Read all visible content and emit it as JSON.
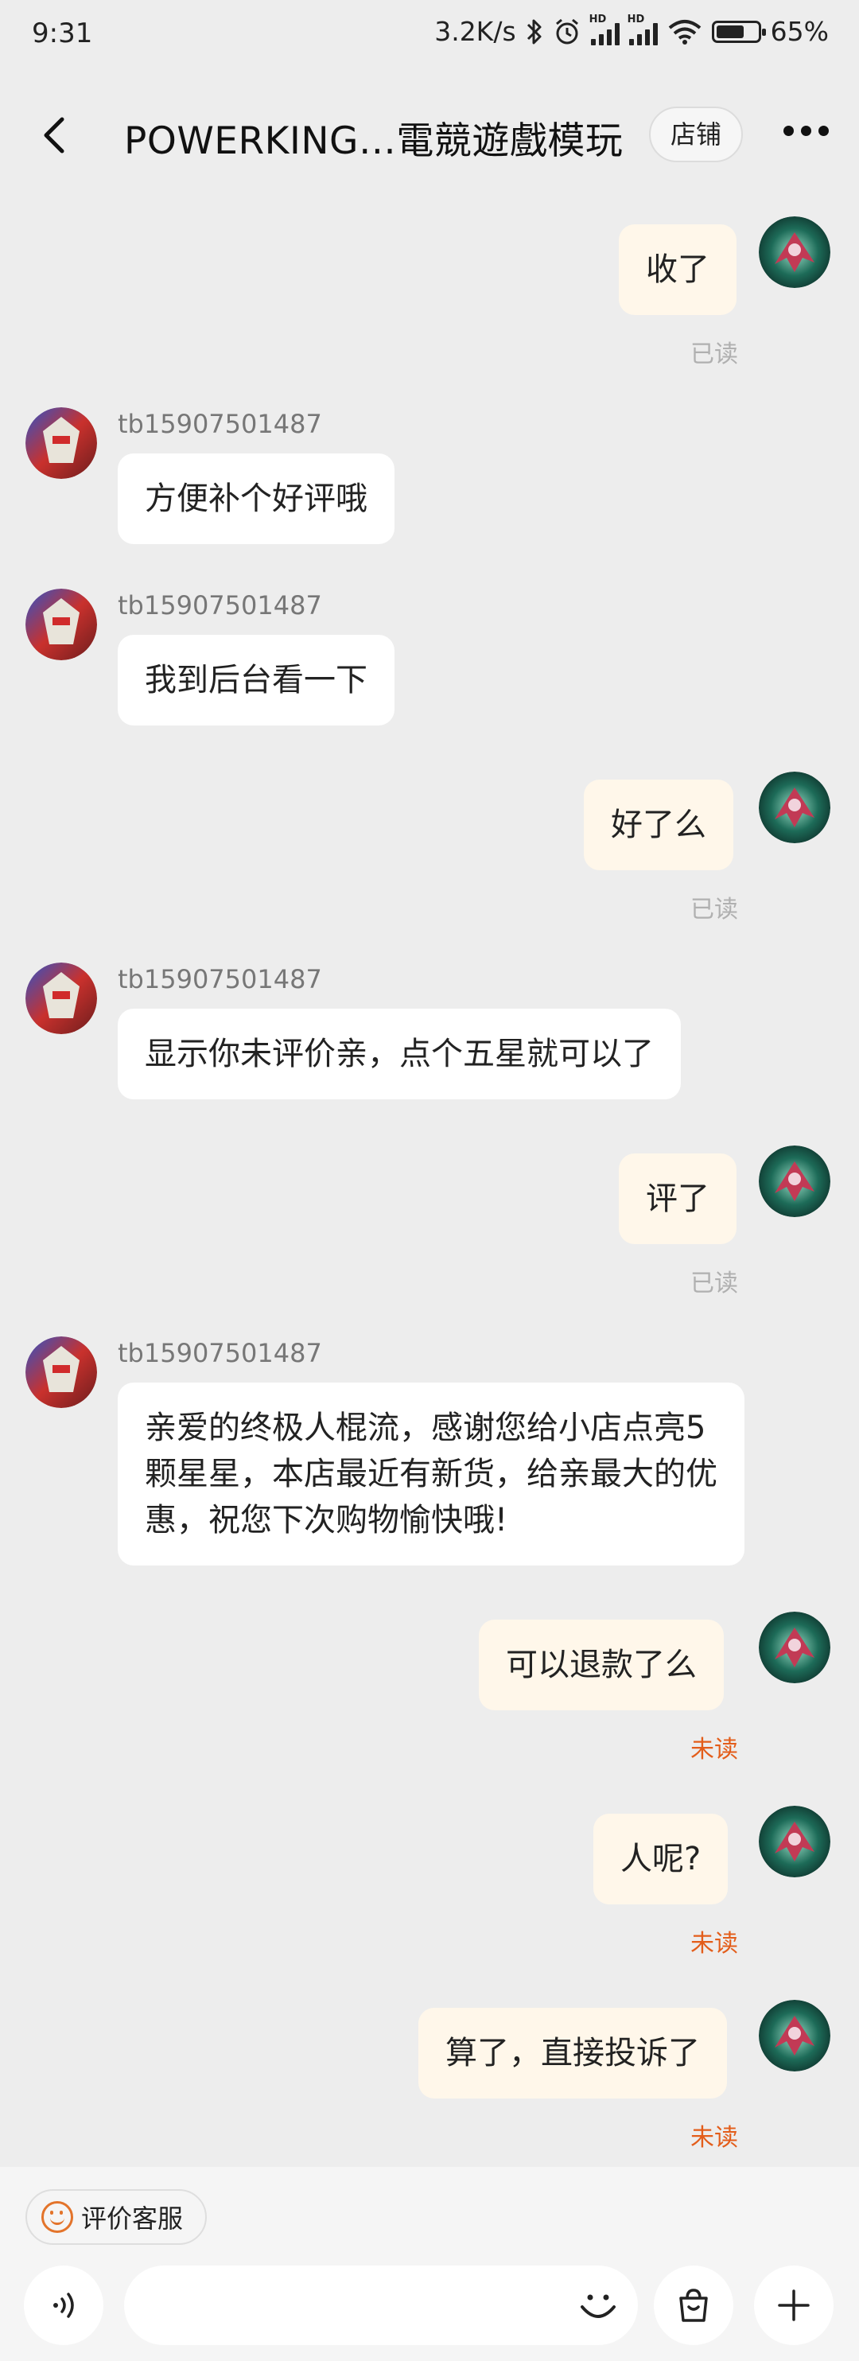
{
  "status_bar": {
    "time": "9:31",
    "net_speed": "3.2K/s",
    "battery_percent": "65%",
    "battery_level": 0.65
  },
  "header": {
    "title": "POWERKING…電競遊戲模玩",
    "store_label": "店铺"
  },
  "contact_name": "tb15907501487",
  "messages": [
    {
      "side": "me",
      "text": "收了",
      "status": "已读"
    },
    {
      "side": "them",
      "sender": "tb15907501487",
      "text": "方便补个好评哦"
    },
    {
      "side": "them",
      "sender": "tb15907501487",
      "text": "我到后台看一下"
    },
    {
      "side": "me",
      "text": "好了么",
      "status": "已读"
    },
    {
      "side": "them",
      "sender": "tb15907501487",
      "text": "显示你未评价亲，点个五星就可以了"
    },
    {
      "side": "me",
      "text": "评了",
      "status": "已读"
    },
    {
      "side": "them",
      "sender": "tb15907501487",
      "text": "亲爱的终极人棍流，感谢您给小店点亮5颗星星，本店最近有新货，给亲最大的优惠，祝您下次购物愉快哦!"
    },
    {
      "side": "me",
      "text": "可以退款了么",
      "status": "未读"
    },
    {
      "side": "me",
      "text": "人呢?",
      "status": "未读"
    },
    {
      "side": "me",
      "text": "算了，直接投诉了",
      "status": "未读"
    }
  ],
  "bottom": {
    "rate_label": "评价客服",
    "input_placeholder": ""
  },
  "colors": {
    "background": "#ededed",
    "my_bubble": "#fff7ea",
    "their_bubble": "#ffffff",
    "read": "#b0b0b0",
    "unread": "#e35d1a"
  }
}
